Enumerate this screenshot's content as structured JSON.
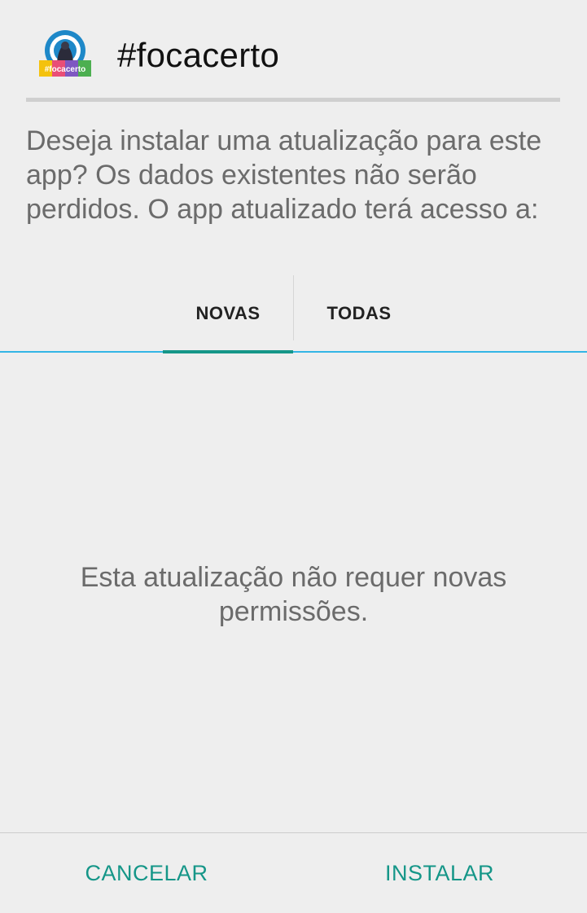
{
  "app": {
    "title": "#focacerto",
    "icon_name": "focacerto-app-icon",
    "icon_label": "#focacerto"
  },
  "message": "Deseja instalar uma atualização para este app? Os dados existentes não serão perdidos. O app atualizado terá acesso a:",
  "tabs": [
    {
      "label": "NOVAS",
      "selected": true
    },
    {
      "label": "TODAS",
      "selected": false
    }
  ],
  "content": {
    "empty_message": "Esta atualização não requer novas permissões."
  },
  "buttons": {
    "cancel_label": "CANCELAR",
    "install_label": "INSTALAR"
  },
  "colors": {
    "accent": "#159688",
    "tab_underline": "#33b5e5",
    "background": "#eeeeee",
    "body_text": "#6b6b6b"
  }
}
